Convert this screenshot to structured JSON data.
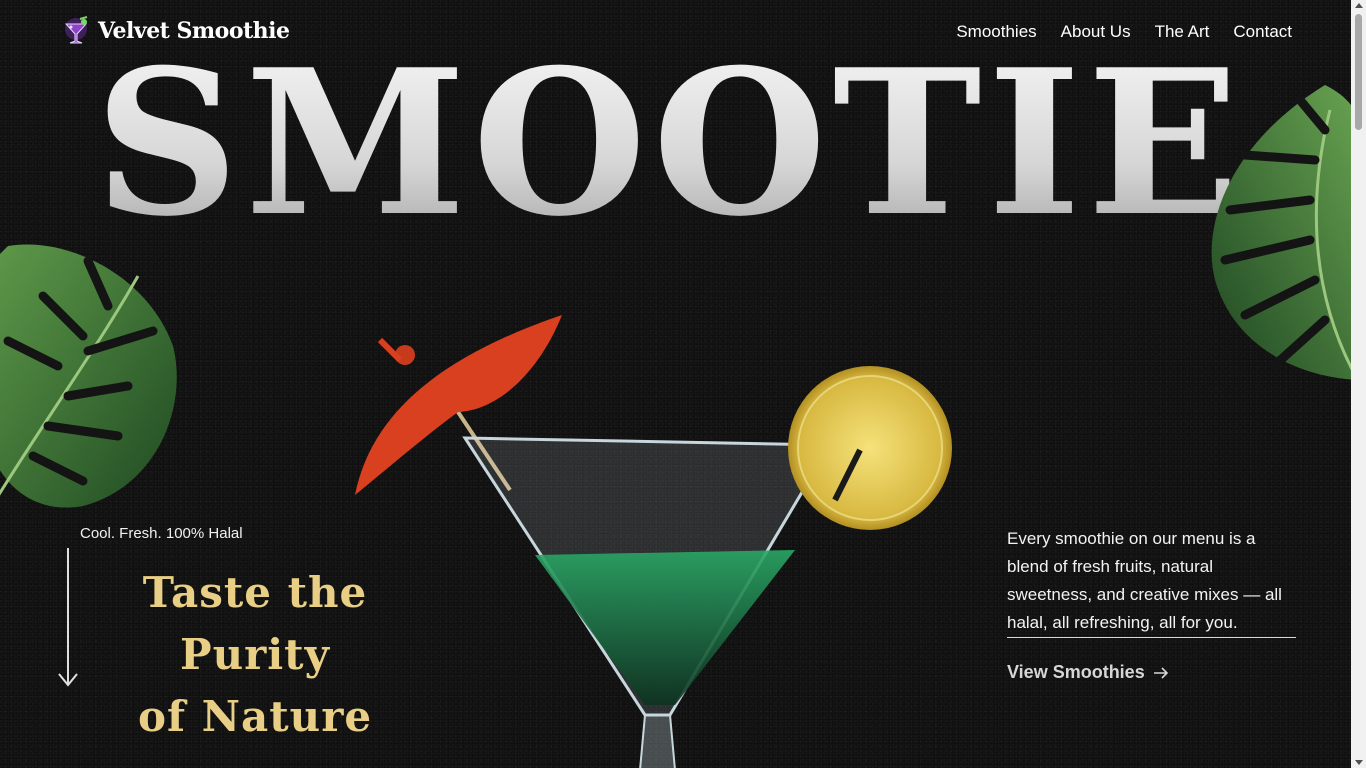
{
  "header": {
    "brand": "Velvet Smoothie",
    "nav": [
      "Smoothies",
      "About Us",
      "The Art",
      "Contact"
    ]
  },
  "hero": {
    "title": "SMOOTIE",
    "tagline": "Cool. Fresh. 100% Halal",
    "headline_line1": "Taste the Purity",
    "headline_line2": "of Nature",
    "description": "Every smoothie on our menu is a blend of fresh fruits, natural sweetness, and creative mixes — all halal, all refreshing, all for you.",
    "cta_label": "View Smoothies"
  },
  "colors": {
    "background": "#141414",
    "accent_gold": "#e9cf86",
    "umbrella_red": "#d9401f",
    "lemon": "#e2c24a",
    "drink_green": "#1f9a5a"
  },
  "icons": {
    "logo": "cocktail-glass-icon",
    "scroll_hint": "arrow-down-icon",
    "cta": "arrow-right-icon"
  }
}
